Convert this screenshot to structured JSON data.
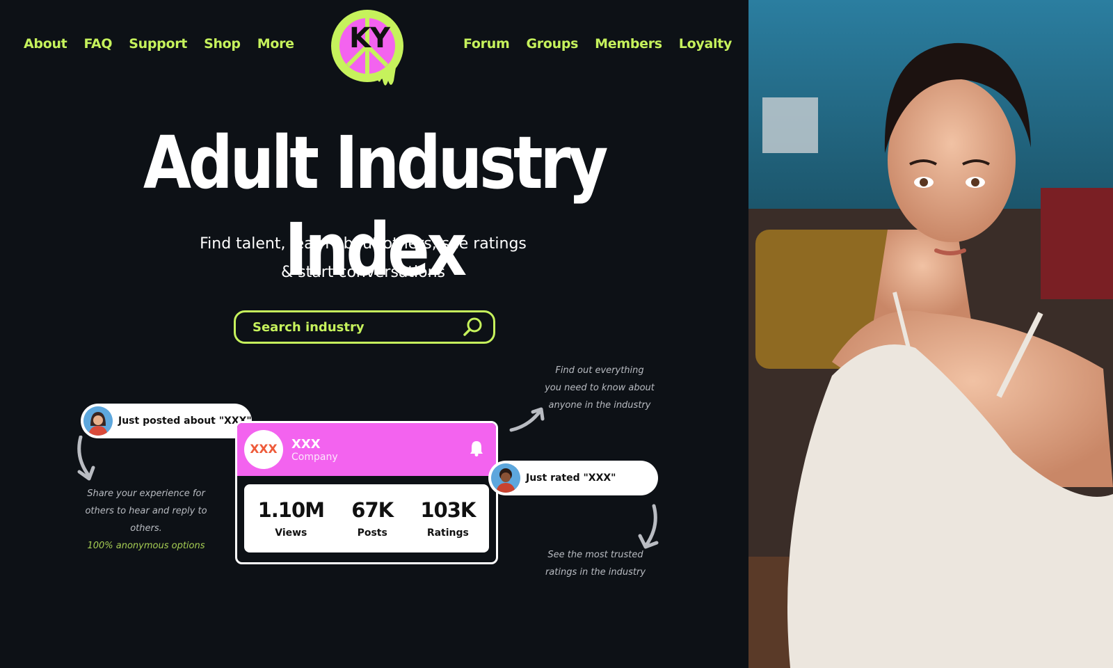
{
  "nav": {
    "left": [
      "About",
      "FAQ",
      "Support",
      "Shop",
      "More"
    ],
    "right": [
      "Forum",
      "Groups",
      "Members",
      "Loyalty"
    ]
  },
  "logo": {
    "text": "KY"
  },
  "hero": {
    "title": "Adult Industry Index",
    "subtitle_line1": "Find talent, learn about others, see ratings",
    "subtitle_line2": "& start conversations"
  },
  "search": {
    "placeholder": "Search industry",
    "value": ""
  },
  "activity": {
    "posted": "Just posted about \"XXX\"",
    "rated": "Just rated \"XXX\""
  },
  "profile_card": {
    "logo_text": "XXX",
    "name": "XXX",
    "type": "Company",
    "stats": [
      {
        "value": "1.10M",
        "label": "Views"
      },
      {
        "value": "67K",
        "label": "Posts"
      },
      {
        "value": "103K",
        "label": "Ratings"
      }
    ]
  },
  "notes": {
    "share_line1": "Share your experience for",
    "share_line2": "others to hear and reply to",
    "share_line3": "others.",
    "share_accent": "100% anonymous options",
    "find_line1": "Find out everything",
    "find_line2": "you need to know about",
    "find_line3": "anyone in the industry",
    "trusted_line1": "See the most trusted",
    "trusted_line2": "ratings in the industry"
  },
  "colors": {
    "background": "#0d1116",
    "accent_green": "#c6f25c",
    "accent_pink": "#f363ef",
    "text_white": "#ffffff"
  },
  "icons": [
    "search-icon",
    "bell-icon",
    "curved-arrow-icon",
    "avatar-icon"
  ]
}
